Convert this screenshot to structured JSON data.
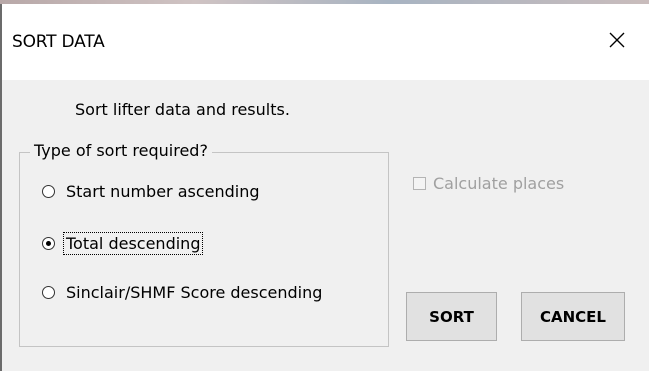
{
  "window": {
    "title": "SORT DATA"
  },
  "description": "Sort lifter data and results.",
  "sort_group": {
    "legend": "Type of sort required?",
    "options": [
      {
        "label": "Start number ascending",
        "checked": false
      },
      {
        "label": "Total descending",
        "checked": true
      },
      {
        "label": "Sinclair/SHMF Score descending",
        "checked": false
      }
    ]
  },
  "calculate_places": {
    "label": "Calculate places",
    "checked": false,
    "enabled": false
  },
  "buttons": {
    "sort_label": "SORT",
    "cancel_label": "CANCEL"
  },
  "icons": {
    "close": "close-icon"
  }
}
